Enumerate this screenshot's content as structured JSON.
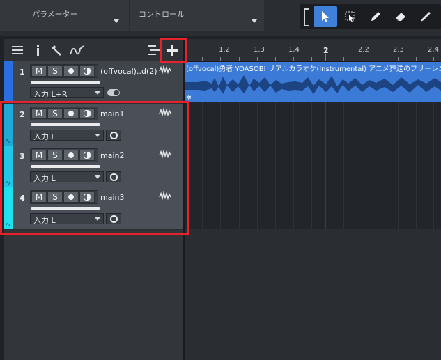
{
  "topbar": {
    "param_label": "パラメーター",
    "control_label": "コントロール",
    "tools": [
      "select-arrow-icon",
      "range-tool-icon",
      "pencil-icon",
      "eraser-icon",
      "paint-icon"
    ]
  },
  "panel": {
    "toolbar_icons": [
      "list-icon",
      "info-icon",
      "wrench-icon",
      "automation-curve-icon",
      "list-settings-icon",
      "add-track-icon"
    ]
  },
  "tracks": [
    {
      "number": "1",
      "mute": "M",
      "solo": "S",
      "name": "(offvocal)..d(2)",
      "input": "入力 L+R",
      "color": "#2a6ee0"
    },
    {
      "number": "2",
      "mute": "M",
      "solo": "S",
      "name": "main1",
      "input": "入力 L",
      "color": "#1fa9d6"
    },
    {
      "number": "3",
      "mute": "M",
      "solo": "S",
      "name": "main2",
      "input": "入力 L",
      "color": "#22c6e6"
    },
    {
      "number": "4",
      "mute": "M",
      "solo": "S",
      "name": "main3",
      "input": "入力 L",
      "color": "#20e0f0"
    }
  ],
  "ruler": {
    "ticks": [
      "1.2",
      "1.3",
      "1.4",
      "2",
      "2.2",
      "2.3",
      "2.4"
    ]
  },
  "clip": {
    "title": "(offvocal)勇者  YOASOBI  リアルカラオケ(Instrumental) アニメ葬送のフリーレンOP"
  },
  "colors": {
    "highlight": "#e8222b",
    "clip_blue": "#3b7ad6",
    "active_tool": "#3f80d8"
  }
}
